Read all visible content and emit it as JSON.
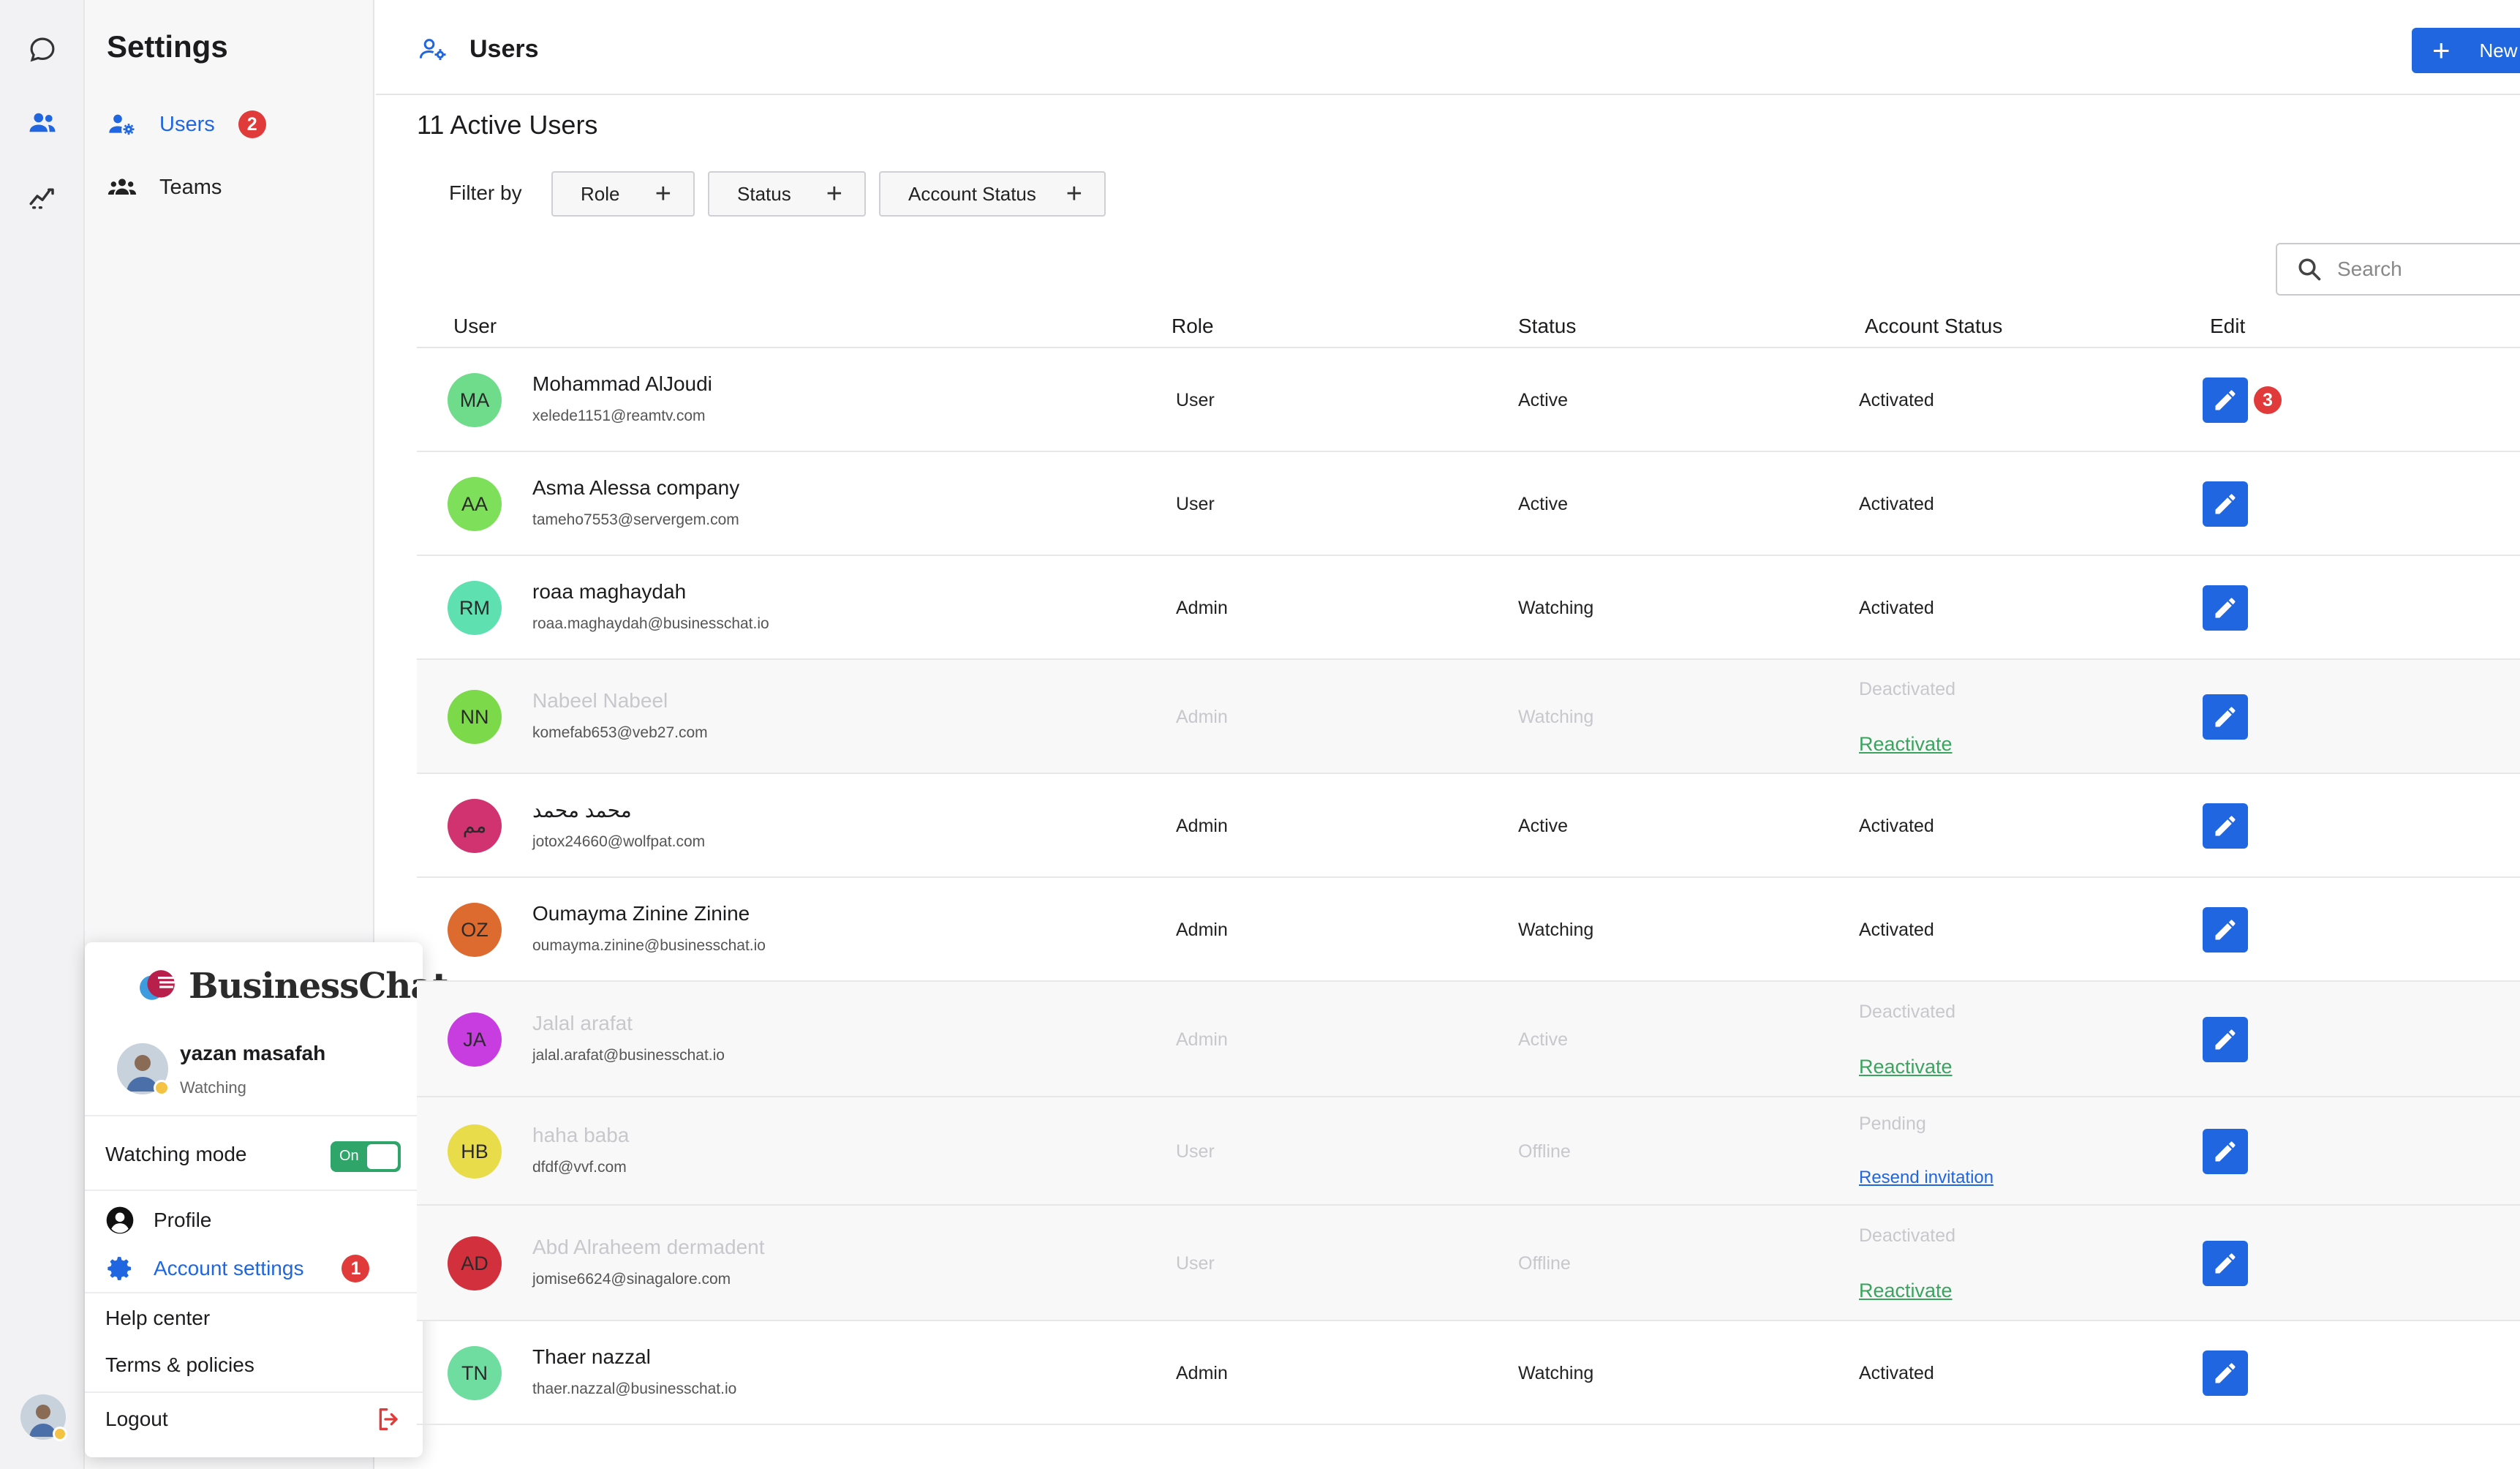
{
  "sidebar": {
    "title": "Settings",
    "items": [
      {
        "label": "Users",
        "badge": "2",
        "icon": "user-gear-icon",
        "active": true
      },
      {
        "label": "Teams",
        "icon": "team-icon",
        "active": false
      }
    ]
  },
  "rail": {
    "icons": [
      "chat-icon",
      "users-icon",
      "analytics-icon"
    ]
  },
  "popup": {
    "brand": "BusinessChat",
    "user_name": "yazan masafah",
    "user_status": "Watching",
    "watching_mode_label": "Watching mode",
    "toggle_label": "On",
    "profile_label": "Profile",
    "account_settings_label": "Account settings",
    "account_settings_badge": "1",
    "help_label": "Help center",
    "terms_label": "Terms & policies",
    "logout_label": "Logout"
  },
  "header": {
    "title": "Users",
    "new_button_label": "New"
  },
  "main": {
    "count_title": "11 Active Users",
    "filter_label": "Filter by",
    "filters": [
      "Role",
      "Status",
      "Account Status"
    ],
    "search_placeholder": "Search",
    "columns": [
      "User",
      "Role",
      "Status",
      "Account Status",
      "Edit"
    ],
    "rows": [
      {
        "initials": "MA",
        "name": "Mohammad AlJoudi",
        "email": "xelede1151@reamtv.com",
        "role": "User",
        "status": "Active",
        "account_status": "Activated",
        "avatar_color": "#6fdc8c",
        "dim": false,
        "badge": "3"
      },
      {
        "initials": "AA",
        "name": "Asma Alessa company",
        "email": "tameho7553@servergem.com",
        "role": "User",
        "status": "Active",
        "account_status": "Activated",
        "avatar_color": "#7ee05a",
        "dim": false
      },
      {
        "initials": "RM",
        "name": "roaa maghaydah",
        "email": "roaa.maghaydah@businesschat.io",
        "role": "Admin",
        "status": "Watching",
        "account_status": "Activated",
        "avatar_color": "#5fe0b0",
        "dim": false
      },
      {
        "initials": "NN",
        "name": "Nabeel Nabeel",
        "email": "komefab653@veb27.com",
        "role": "Admin",
        "status": "Watching",
        "account_status": "Deactivated",
        "action": "Reactivate",
        "avatar_color": "#7cd94a",
        "dim": true
      },
      {
        "initials": "مم",
        "name": "محمد محمد",
        "email": "jotox24660@wolfpat.com",
        "role": "Admin",
        "status": "Active",
        "account_status": "Activated",
        "avatar_color": "#d0336f",
        "dim": false
      },
      {
        "initials": "OZ",
        "name": "Oumayma Zinine Zinine",
        "email": "oumayma.zinine@businesschat.io",
        "role": "Admin",
        "status": "Watching",
        "account_status": "Activated",
        "avatar_color": "#dd6b30",
        "dim": false
      },
      {
        "initials": "JA",
        "name": "Jalal arafat",
        "email": "jalal.arafat@businesschat.io",
        "role": "Admin",
        "status": "Active",
        "account_status": "Deactivated",
        "action": "Reactivate",
        "avatar_color": "#c83de0",
        "dim": true
      },
      {
        "initials": "HB",
        "name": "haha baba",
        "email": "dfdf@vvf.com",
        "role": "User",
        "status": "Offline",
        "account_status": "Pending",
        "action": "Resend invitation",
        "avatar_color": "#e9dc4a",
        "dim": true
      },
      {
        "initials": "AD",
        "name": "Abd Alraheem dermadent",
        "email": "jomise6624@sinagalore.com",
        "role": "User",
        "status": "Offline",
        "account_status": "Deactivated",
        "action": "Reactivate",
        "avatar_color": "#d3303d",
        "dim": true
      },
      {
        "initials": "TN",
        "name": "Thaer nazzal",
        "email": "thaer.nazzal@businesschat.io",
        "role": "Admin",
        "status": "Watching",
        "account_status": "Activated",
        "avatar_color": "#6fdca0",
        "dim": false
      }
    ]
  },
  "colors": {
    "accent": "#1f66e0",
    "badge": "#e03a3a",
    "reactivate": "#3aa45f",
    "toggle_on": "#2fa56a"
  }
}
